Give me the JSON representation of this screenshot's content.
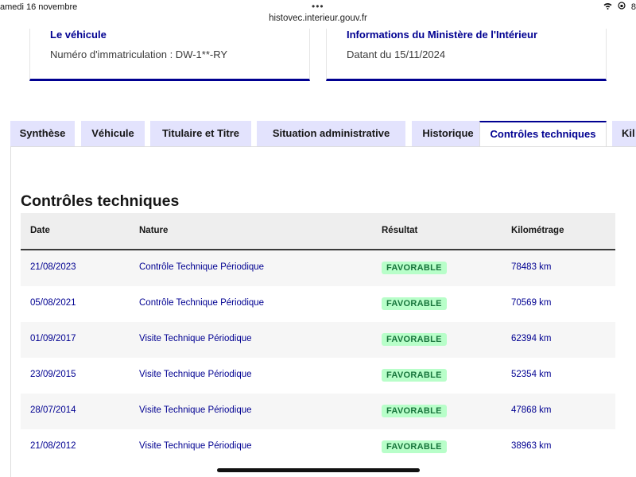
{
  "statusbar": {
    "date": "amedi 16 novembre",
    "dots": "•••",
    "url": "histovec.interieur.gouv.fr",
    "right": "8"
  },
  "cards": {
    "vehicle": {
      "title": "Le véhicule",
      "text": "Numéro d'immatriculation : DW-1**-RY"
    },
    "ministry": {
      "title": "Informations du Ministère de l'Intérieur",
      "text": "Datant du 15/11/2024"
    }
  },
  "tabs": [
    {
      "label": "Synthèse"
    },
    {
      "label": "Véhicule"
    },
    {
      "label": "Titulaire et Titre"
    },
    {
      "label": "Situation administrative"
    },
    {
      "label": "Historique"
    },
    {
      "label": "Contrôles techniques"
    },
    {
      "label": "Kil"
    }
  ],
  "active_tab": "Contrôles techniques",
  "section": {
    "title": "Contrôles techniques"
  },
  "table": {
    "headers": {
      "date": "Date",
      "nature": "Nature",
      "result": "Résultat",
      "km": "Kilométrage"
    },
    "rows": [
      {
        "date": "21/08/2023",
        "nature": "Contrôle Technique Périodique",
        "result": "FAVORABLE",
        "km": "78483 km"
      },
      {
        "date": "05/08/2021",
        "nature": "Contrôle Technique Périodique",
        "result": "FAVORABLE",
        "km": "70569 km"
      },
      {
        "date": "01/09/2017",
        "nature": "Visite Technique Périodique",
        "result": "FAVORABLE",
        "km": "62394 km"
      },
      {
        "date": "23/09/2015",
        "nature": "Visite Technique Périodique",
        "result": "FAVORABLE",
        "km": "52354 km"
      },
      {
        "date": "28/07/2014",
        "nature": "Visite Technique Périodique",
        "result": "FAVORABLE",
        "km": "47868 km"
      },
      {
        "date": "21/08/2012",
        "nature": "Visite Technique Périodique",
        "result": "FAVORABLE",
        "km": "38963 km"
      }
    ]
  },
  "colors": {
    "accent": "#000091",
    "tab_bg": "#e3e3fd",
    "badge_bg": "#b8fec9",
    "badge_text": "#18753c"
  }
}
